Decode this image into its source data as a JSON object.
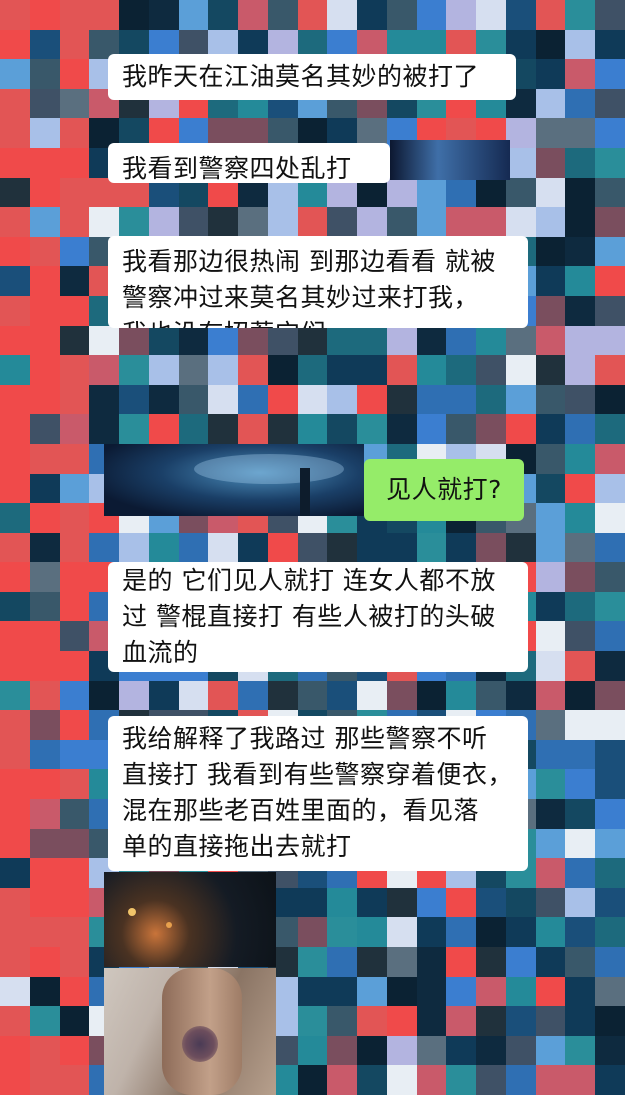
{
  "messages": [
    {
      "id": "m1",
      "side": "received",
      "text": "我昨天在江油莫名其妙的被打了"
    },
    {
      "id": "m2",
      "side": "received",
      "text": "我看到警察四处乱打人"
    },
    {
      "id": "m3",
      "side": "received",
      "text": "我看那边很热闹 到那边看看 就被\n警察冲过来莫名其妙过来打我，\n我也没有招惹它们"
    },
    {
      "id": "m4",
      "side": "sent",
      "text": "见人就打?"
    },
    {
      "id": "m5",
      "side": "received",
      "text": "是的 它们见人就打 连女人都不放\n过 警棍直接打 有些人被打的头破\n血流的"
    },
    {
      "id": "m6",
      "side": "received",
      "text": "我给解释了我路过 那些警察不听\n直接打 我看到有些警察穿着便衣，\n混在那些老百姓里面的，看见落\n单的直接拖出去就打"
    }
  ],
  "images": [
    {
      "name": "night-sky-image",
      "kind": "photo"
    },
    {
      "name": "bruised-arm-photo",
      "kind": "photo"
    }
  ],
  "colors": {
    "sent_bubble": "#95ec69",
    "received_bubble": "#ffffff",
    "text": "#111111"
  }
}
